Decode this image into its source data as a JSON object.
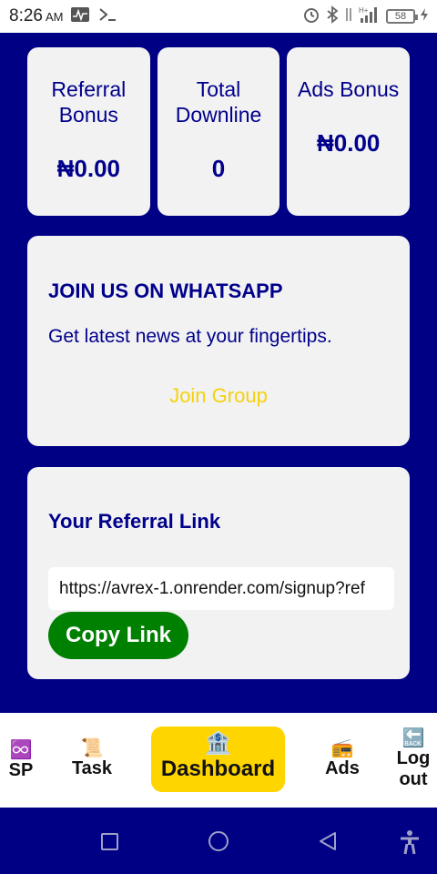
{
  "status_bar": {
    "time": "8:26",
    "ampm": "AM",
    "battery": "58",
    "network": "H+"
  },
  "stats": [
    {
      "label_line1": "Referral",
      "label_line2": "Bonus",
      "value": "₦0.00"
    },
    {
      "label_line1": "Total",
      "label_line2": "Downline",
      "value": "0"
    },
    {
      "label_line1": "Ads Bonus",
      "label_line2": "",
      "value": "₦0.00"
    }
  ],
  "whatsapp": {
    "title": "JOIN US ON WHATSAPP",
    "text": "Get latest news at your fingertips.",
    "link": "Join Group"
  },
  "referral": {
    "title": "Your Referral Link",
    "link_value": "https://avrex-1.onrender.com/signup?ref",
    "button": "Copy Link"
  },
  "bottom_nav": {
    "sp": {
      "icon": "♾️",
      "label": "SP"
    },
    "task": {
      "icon": "📜",
      "label": "Task"
    },
    "dashboard": {
      "icon": "🏦",
      "label": "Dashboard"
    },
    "ads": {
      "icon": "📻",
      "label": "Ads"
    },
    "logout": {
      "icon": "🔙",
      "label_line1": "Log",
      "label_line2": "out"
    }
  },
  "colors": {
    "background": "#000085",
    "card": "#f2f2f3",
    "accent_text": "#00008b",
    "join_link": "#f5d20c",
    "copy_button": "#008000",
    "dashboard_active": "#ffd500"
  }
}
